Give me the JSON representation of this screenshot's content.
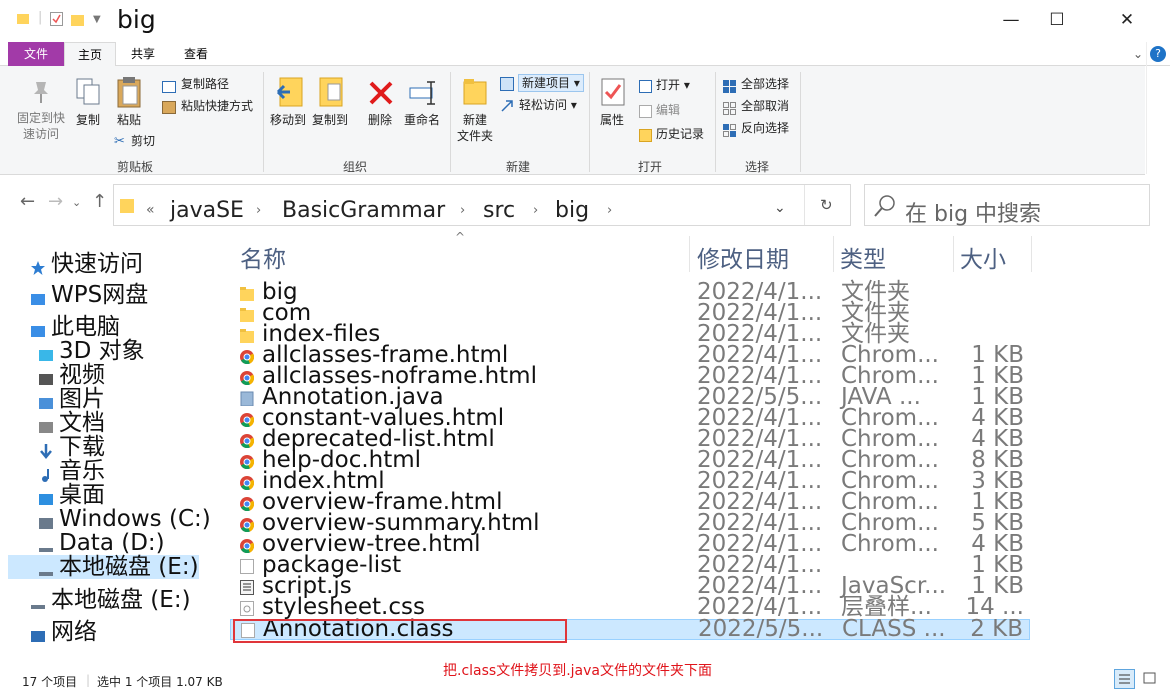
{
  "window": {
    "title": "big",
    "minimize": "—",
    "maximize": "☐",
    "close": "✕",
    "help": "?"
  },
  "tabs": [
    "文件",
    "主页",
    "共享",
    "查看"
  ],
  "ribbon": {
    "clipboard": {
      "pin": [
        "固定到快",
        "速访问"
      ],
      "copy": "复制",
      "paste": "粘贴",
      "copy_path": "复制路径",
      "paste_shortcut": "粘贴快捷方式",
      "cut": "剪切",
      "label": "剪贴板"
    },
    "organize": {
      "move_to": "移动到",
      "copy_to": "复制到",
      "delete": "删除",
      "rename": "重命名",
      "label": "组织"
    },
    "new": {
      "new_folder": [
        "新建",
        "文件夹"
      ],
      "new_item": "新建项目",
      "easy_access": "轻松访问",
      "label": "新建"
    },
    "open": {
      "properties": "属性",
      "open": "打开",
      "edit": "编辑",
      "history": "历史记录",
      "label": "打开"
    },
    "select": {
      "select_all": "全部选择",
      "select_none": "全部取消",
      "invert": "反向选择",
      "label": "选择"
    }
  },
  "address": {
    "prefix": "«",
    "crumbs": [
      "javaSE",
      "BasicGrammar",
      "src",
      "big"
    ],
    "search_placeholder": "在 big 中搜索"
  },
  "nav": [
    {
      "label": "快速访问",
      "icon": "star-icon"
    },
    {
      "label": "WPS网盘",
      "icon": "cloud-icon"
    },
    {
      "label": "此电脑",
      "icon": "computer-icon"
    },
    {
      "label": "3D 对象",
      "icon": "cube-icon"
    },
    {
      "label": "视频",
      "icon": "video-icon"
    },
    {
      "label": "图片",
      "icon": "picture-icon"
    },
    {
      "label": "文档",
      "icon": "document-icon"
    },
    {
      "label": "下载",
      "icon": "download-icon"
    },
    {
      "label": "音乐",
      "icon": "music-icon"
    },
    {
      "label": "桌面",
      "icon": "desktop-icon"
    },
    {
      "label": "Windows (C:)",
      "icon": "windows-drive-icon"
    },
    {
      "label": "Data (D:)",
      "icon": "drive-icon"
    },
    {
      "label": "本地磁盘 (E:)",
      "icon": "drive-icon"
    },
    {
      "label": "本地磁盘 (E:)",
      "icon": "drive-icon"
    },
    {
      "label": "网络",
      "icon": "network-icon"
    }
  ],
  "columns": {
    "name": "名称",
    "date": "修改日期",
    "type": "类型",
    "size": "大小"
  },
  "files": [
    {
      "name": "big",
      "date": "2022/4/1...",
      "type": "文件夹",
      "size": "",
      "icon": "folder-icon"
    },
    {
      "name": "com",
      "date": "2022/4/1...",
      "type": "文件夹",
      "size": "",
      "icon": "folder-icon"
    },
    {
      "name": "index-files",
      "date": "2022/4/1...",
      "type": "文件夹",
      "size": "",
      "icon": "folder-icon"
    },
    {
      "name": "allclasses-frame.html",
      "date": "2022/4/1...",
      "type": "Chrom...",
      "size": "1 KB",
      "icon": "chrome-icon"
    },
    {
      "name": "allclasses-noframe.html",
      "date": "2022/4/1...",
      "type": "Chrom...",
      "size": "1 KB",
      "icon": "chrome-icon"
    },
    {
      "name": "Annotation.java",
      "date": "2022/5/5...",
      "type": "JAVA ...",
      "size": "1 KB",
      "icon": "java-file-icon"
    },
    {
      "name": "constant-values.html",
      "date": "2022/4/1...",
      "type": "Chrom...",
      "size": "4 KB",
      "icon": "chrome-icon"
    },
    {
      "name": "deprecated-list.html",
      "date": "2022/4/1...",
      "type": "Chrom...",
      "size": "4 KB",
      "icon": "chrome-icon"
    },
    {
      "name": "help-doc.html",
      "date": "2022/4/1...",
      "type": "Chrom...",
      "size": "8 KB",
      "icon": "chrome-icon"
    },
    {
      "name": "index.html",
      "date": "2022/4/1...",
      "type": "Chrom...",
      "size": "3 KB",
      "icon": "chrome-icon"
    },
    {
      "name": "overview-frame.html",
      "date": "2022/4/1...",
      "type": "Chrom...",
      "size": "1 KB",
      "icon": "chrome-icon"
    },
    {
      "name": "overview-summary.html",
      "date": "2022/4/1...",
      "type": "Chrom...",
      "size": "5 KB",
      "icon": "chrome-icon"
    },
    {
      "name": "overview-tree.html",
      "date": "2022/4/1...",
      "type": "Chrom...",
      "size": "4 KB",
      "icon": "chrome-icon"
    },
    {
      "name": "package-list",
      "date": "2022/4/1...",
      "type": "",
      "size": "1 KB",
      "icon": "blank-file-icon"
    },
    {
      "name": "script.js",
      "date": "2022/4/1...",
      "type": "JavaScr...",
      "size": "1 KB",
      "icon": "script-file-icon"
    },
    {
      "name": "stylesheet.css",
      "date": "2022/4/1...",
      "type": "层叠样...",
      "size": "14 ...",
      "icon": "css-file-icon"
    },
    {
      "name": "Annotation.class",
      "date": "2022/5/5...",
      "type": "CLASS ...",
      "size": "2 KB",
      "icon": "blank-file-icon"
    }
  ],
  "status": {
    "count": "17 个项目",
    "selected": "选中 1 个项目  1.07 KB"
  },
  "annotation": "把.class文件拷贝到.java文件的文件夹下面",
  "colors": {
    "selection": "#cce8ff",
    "file_tab": "#a23aa8",
    "annotation": "#e0141b",
    "folder": "#ffd45c"
  }
}
